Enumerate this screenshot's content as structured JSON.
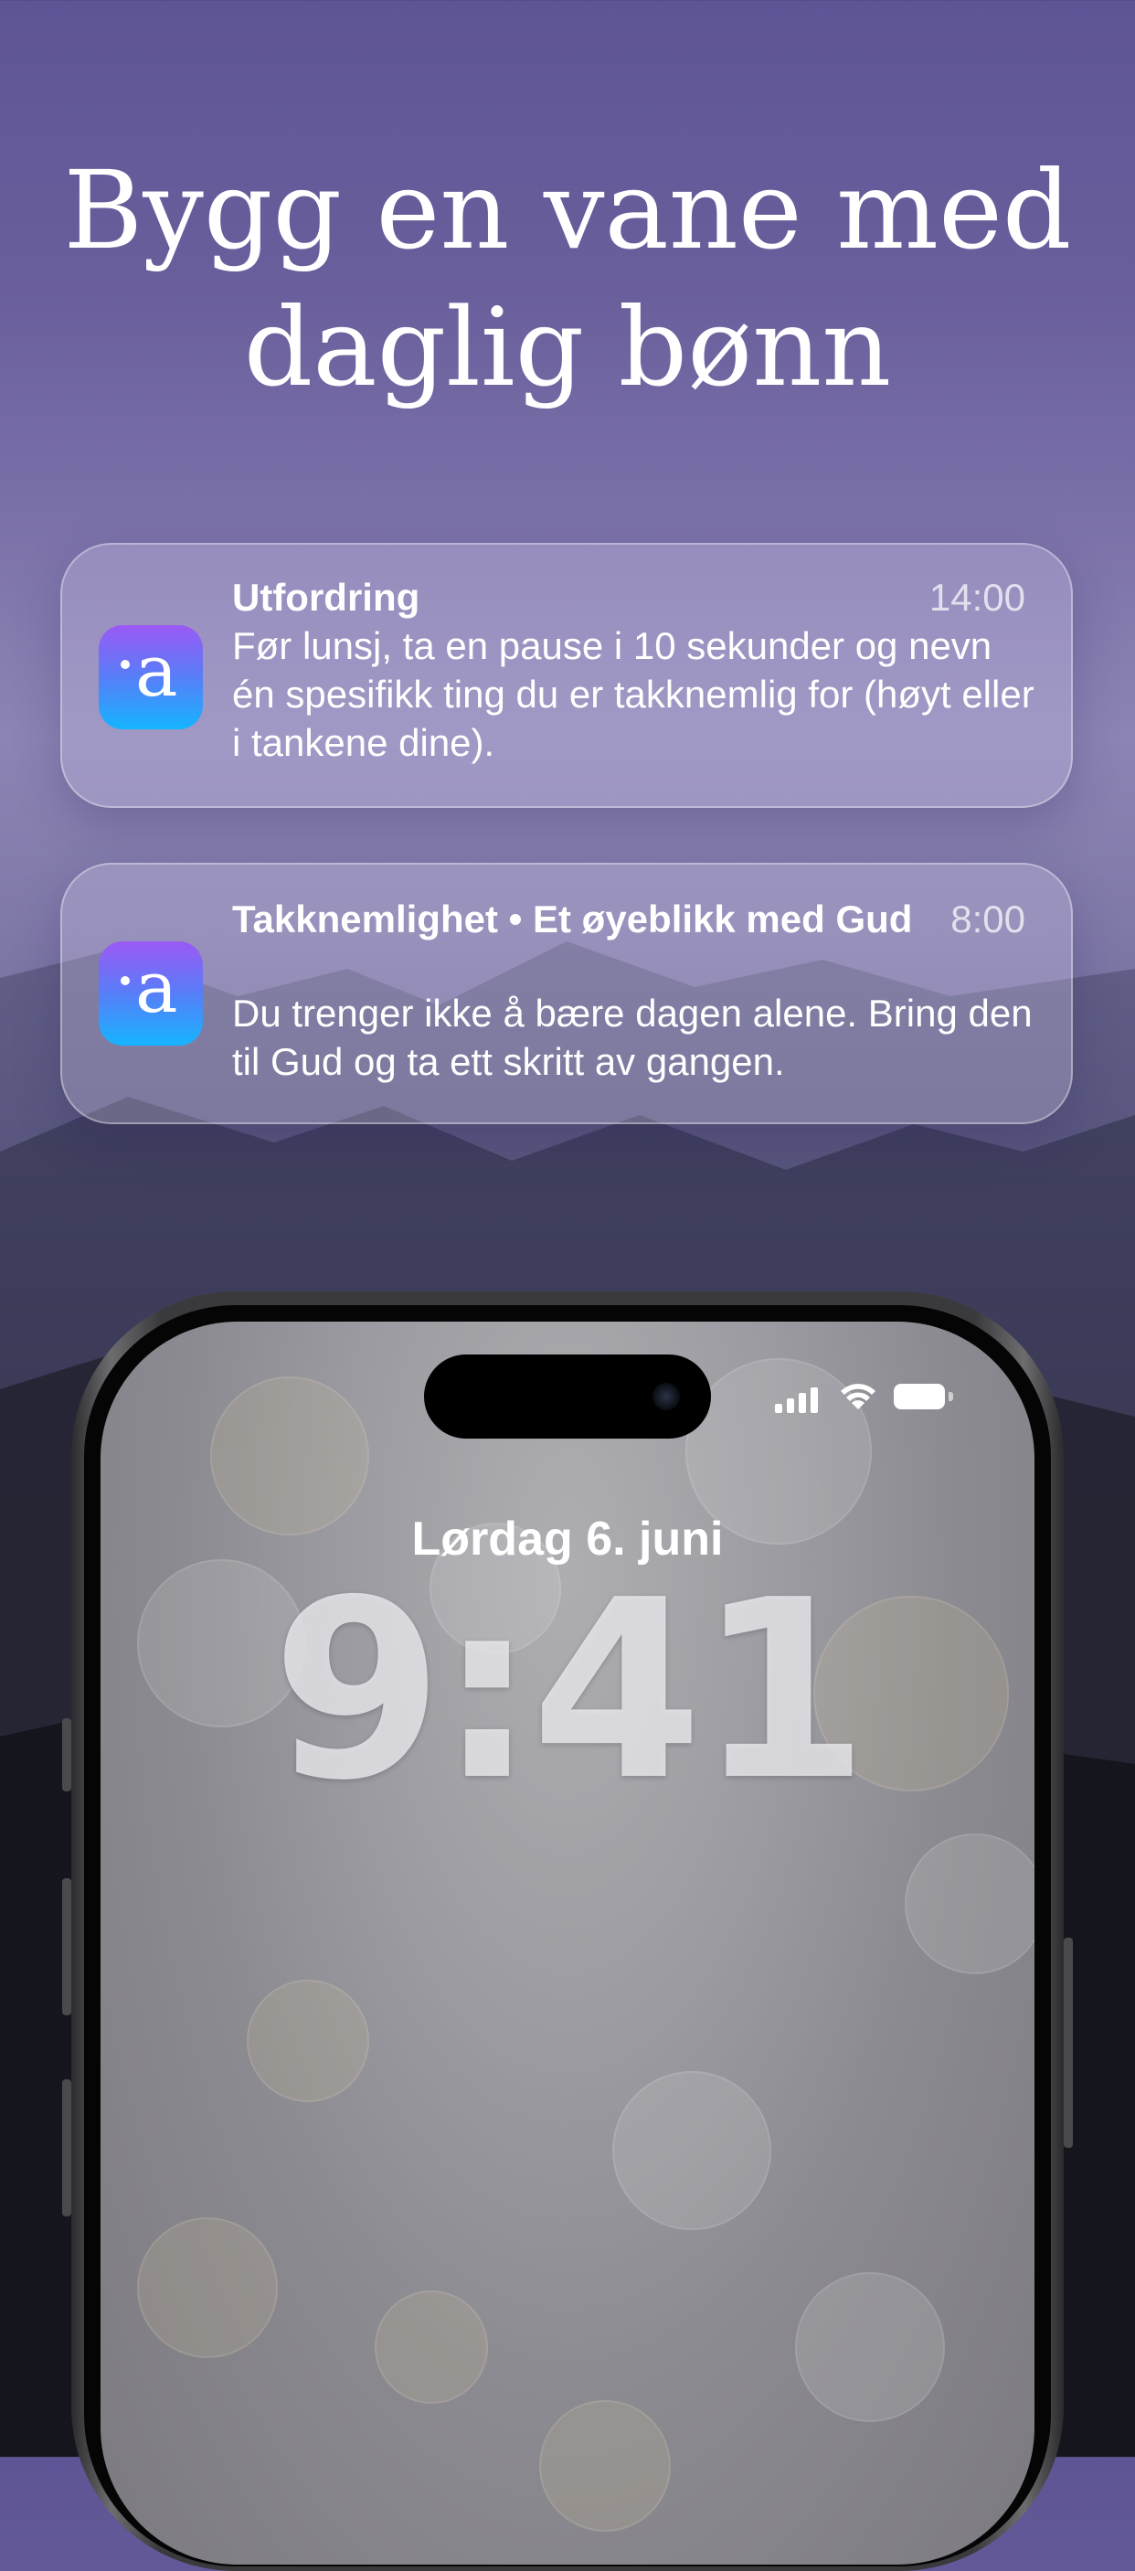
{
  "headline": {
    "line1": "Bygg en vane med",
    "line2": "daglig bønn"
  },
  "notifications": [
    {
      "app_icon": "app-a-icon",
      "title": "Utfordring",
      "time": "14:00",
      "body": "Før lunsj, ta en pause i 10 sekunder og nevn én spesifikk ting du er takknemlig for (høyt eller i tankene dine)."
    },
    {
      "app_icon": "app-a-icon",
      "title": "Takknemlighet • Et øyeblikk med Gud",
      "time": "8:00",
      "body": "Du trenger ikke å bære dagen alene. Bring den til Gud og ta ett skritt av gangen."
    }
  ],
  "lockscreen": {
    "date": "Lørdag 6. juni",
    "time": "9:41"
  },
  "app_icon_glyph": "a",
  "colors": {
    "icon_gradient_top": "#9b59f5",
    "icon_gradient_bottom": "#16b4ff",
    "background_top": "#5e5596",
    "background_bottom": "#14151c"
  }
}
